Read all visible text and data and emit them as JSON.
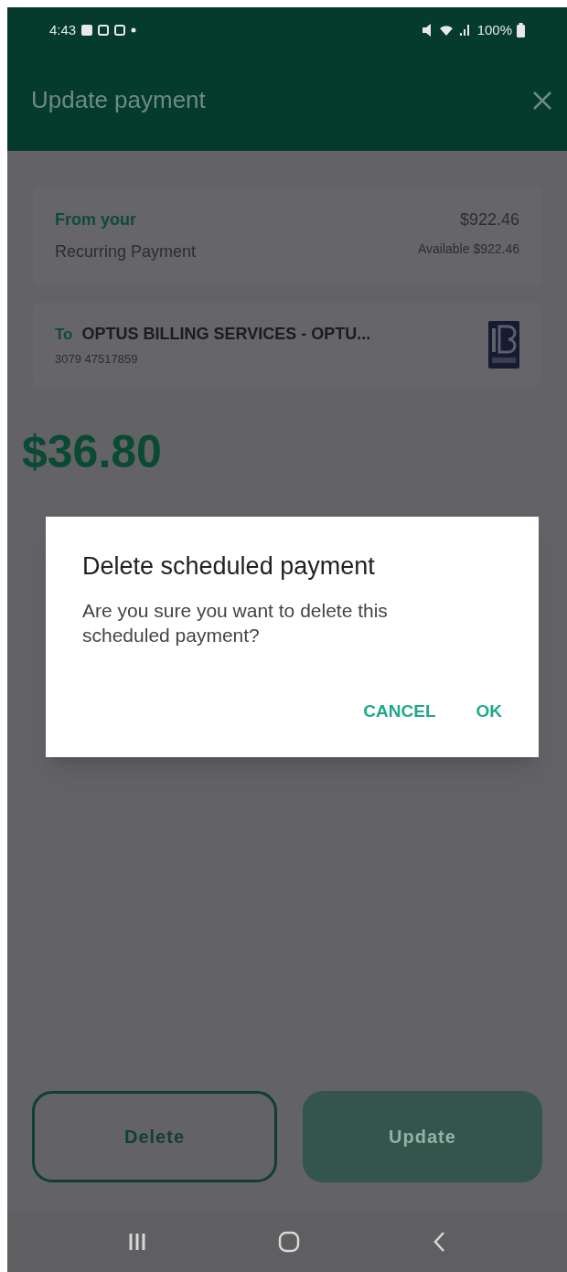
{
  "status_bar": {
    "time": "4:43",
    "battery": "100%"
  },
  "header": {
    "title": "Update payment"
  },
  "from_card": {
    "label": "From your",
    "account": "Recurring Payment",
    "balance": "$922.46",
    "available": "Available $922.46"
  },
  "to_card": {
    "prefix": "To",
    "payee": "OPTUS BILLING SERVICES - OPTU...",
    "reference": "3079 47517859"
  },
  "amount": "$36.80",
  "dialog": {
    "title": "Delete scheduled payment",
    "message": "Are you sure you want to delete this scheduled payment?",
    "buttons": [
      {
        "label": "CANCEL"
      },
      {
        "label": "OK"
      }
    ]
  },
  "actions": [
    {
      "kind": "outline",
      "label": "Delete",
      "disabled": false
    },
    {
      "kind": "filled",
      "label": "Update",
      "disabled": true
    }
  ]
}
